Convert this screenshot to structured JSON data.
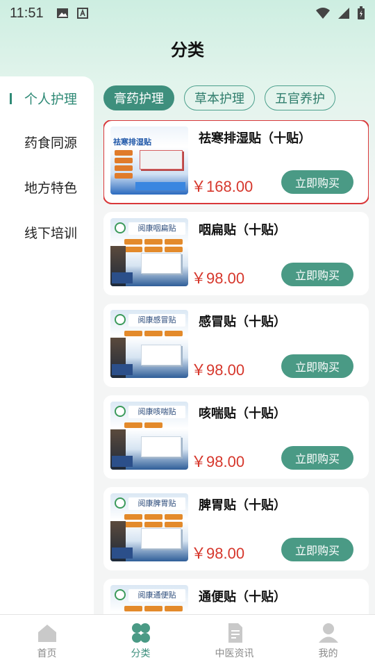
{
  "status_bar": {
    "time": "11:51"
  },
  "header": {
    "title": "分类"
  },
  "sidebar": {
    "items": [
      {
        "label": "个人护理",
        "active": true
      },
      {
        "label": "药食同源",
        "active": false
      },
      {
        "label": "地方特色",
        "active": false
      },
      {
        "label": "线下培训",
        "active": false
      }
    ]
  },
  "tabs": [
    {
      "label": "膏药护理",
      "active": true
    },
    {
      "label": "草本护理",
      "active": false
    },
    {
      "label": "五官养护",
      "active": false
    }
  ],
  "products": [
    {
      "name": "祛寒排湿贴（十贴）",
      "price": "￥168.00",
      "button": "立即购买",
      "thumb_text": "祛寒排湿贴"
    },
    {
      "name": "咽扁贴（十贴）",
      "price": "￥98.00",
      "button": "立即购买",
      "thumb_text": "阅康咽扁贴"
    },
    {
      "name": "感冒贴（十贴）",
      "price": "￥98.00",
      "button": "立即购买",
      "thumb_text": "阅康感冒贴"
    },
    {
      "name": "咳喘贴（十贴）",
      "price": "￥98.00",
      "button": "立即购买",
      "thumb_text": "阅康咳喘贴"
    },
    {
      "name": "脾胃贴（十贴）",
      "price": "￥98.00",
      "button": "立即购买",
      "thumb_text": "阅康脾胃贴"
    },
    {
      "name": "通便贴（十贴）",
      "price": "",
      "button": "",
      "thumb_text": "阅康通便贴"
    }
  ],
  "bottom_nav": [
    {
      "label": "首页",
      "icon": "home-icon",
      "active": false
    },
    {
      "label": "分类",
      "icon": "clover-icon",
      "active": true
    },
    {
      "label": "中医资讯",
      "icon": "document-icon",
      "active": false
    },
    {
      "label": "我的",
      "icon": "user-icon",
      "active": false
    }
  ],
  "colors": {
    "accent": "#3e8f7d",
    "price": "#d6372c",
    "highlight": "#d9383a"
  }
}
